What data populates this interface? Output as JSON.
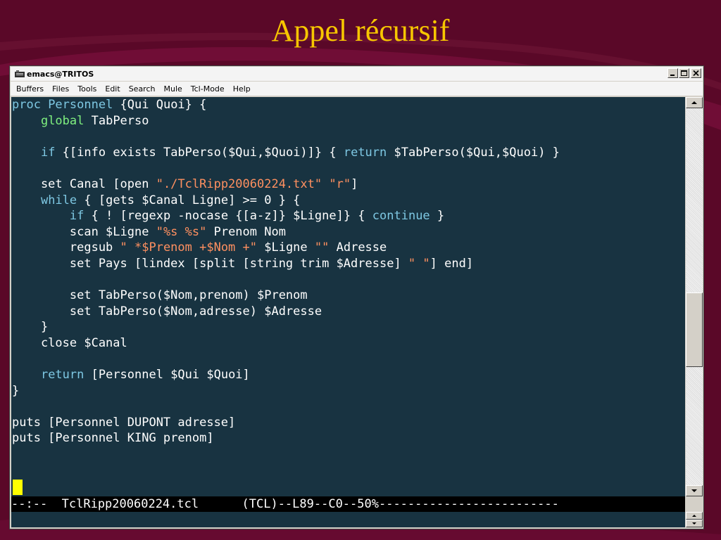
{
  "slide": {
    "title": "Appel récursif"
  },
  "window": {
    "title": "emacs@TRITOS",
    "icon": "emacs-app-icon",
    "controls": [
      "minimize-icon",
      "maximize-icon",
      "close-icon"
    ]
  },
  "menu": [
    {
      "label": "Buffers"
    },
    {
      "label": "Files"
    },
    {
      "label": "Tools"
    },
    {
      "label": "Edit"
    },
    {
      "label": "Search"
    },
    {
      "label": "Mule"
    },
    {
      "label": "Tcl-Mode"
    },
    {
      "label": "Help"
    }
  ],
  "colors": {
    "background": "#5a0828",
    "title": "#f7c600",
    "editor_bg": "#183341",
    "keyword": "#7ec8e3",
    "global": "#7ff07f",
    "string": "#ff9060",
    "cursor": "#ffff00"
  },
  "code_lines": [
    [
      [
        "kw",
        "proc "
      ],
      [
        "fn",
        "Personnel"
      ],
      [
        "t",
        " {Qui Quoi} {"
      ]
    ],
    [
      [
        "t",
        "    "
      ],
      [
        "glb",
        "global"
      ],
      [
        "t",
        " TabPerso"
      ]
    ],
    [
      [
        "t",
        ""
      ]
    ],
    [
      [
        "t",
        "    "
      ],
      [
        "kw",
        "if"
      ],
      [
        "t",
        " {[info exists TabPerso($Qui,$Quoi)]} { "
      ],
      [
        "kw",
        "return"
      ],
      [
        "t",
        " $TabPerso($Qui,$Quoi) }"
      ]
    ],
    [
      [
        "t",
        ""
      ]
    ],
    [
      [
        "t",
        "    set Canal [open "
      ],
      [
        "str",
        "\"./TclRipp20060224.txt\""
      ],
      [
        "t",
        " "
      ],
      [
        "str",
        "\"r\""
      ],
      [
        "t",
        "]"
      ]
    ],
    [
      [
        "t",
        "    "
      ],
      [
        "kw",
        "while"
      ],
      [
        "t",
        " { [gets $Canal Ligne] >= 0 } {"
      ]
    ],
    [
      [
        "t",
        "        "
      ],
      [
        "kw",
        "if"
      ],
      [
        "t",
        " { ! [regexp -nocase {[a-z]} $Ligne]} { "
      ],
      [
        "kw",
        "continue"
      ],
      [
        "t",
        " }"
      ]
    ],
    [
      [
        "t",
        "        scan $Ligne "
      ],
      [
        "str",
        "\"%s %s\""
      ],
      [
        "t",
        " Prenom Nom"
      ]
    ],
    [
      [
        "t",
        "        regsub "
      ],
      [
        "str",
        "\" *$Prenom +$Nom +\""
      ],
      [
        "t",
        " $Ligne "
      ],
      [
        "str",
        "\"\""
      ],
      [
        "t",
        " Adresse"
      ]
    ],
    [
      [
        "t",
        "        set Pays [lindex [split [string trim $Adresse] "
      ],
      [
        "str",
        "\" \""
      ],
      [
        "t",
        "] end]"
      ]
    ],
    [
      [
        "t",
        ""
      ]
    ],
    [
      [
        "t",
        "        set TabPerso($Nom,prenom) $Prenom"
      ]
    ],
    [
      [
        "t",
        "        set TabPerso($Nom,adresse) $Adresse"
      ]
    ],
    [
      [
        "t",
        "    }"
      ]
    ],
    [
      [
        "t",
        "    close $Canal"
      ]
    ],
    [
      [
        "t",
        ""
      ]
    ],
    [
      [
        "t",
        "    "
      ],
      [
        "kw",
        "return"
      ],
      [
        "t",
        " [Personnel $Qui $Quoi]"
      ]
    ],
    [
      [
        "t",
        "}"
      ]
    ],
    [
      [
        "t",
        ""
      ]
    ],
    [
      [
        "t",
        "puts [Personnel DUPONT adresse]"
      ]
    ],
    [
      [
        "t",
        "puts [Personnel KING prenom]"
      ]
    ]
  ],
  "modeline": {
    "text": "--:--  TclRipp20060224.tcl      (TCL)--L89--C0--50%-------------------------"
  },
  "scrollbar": {
    "position_percent": 50
  }
}
